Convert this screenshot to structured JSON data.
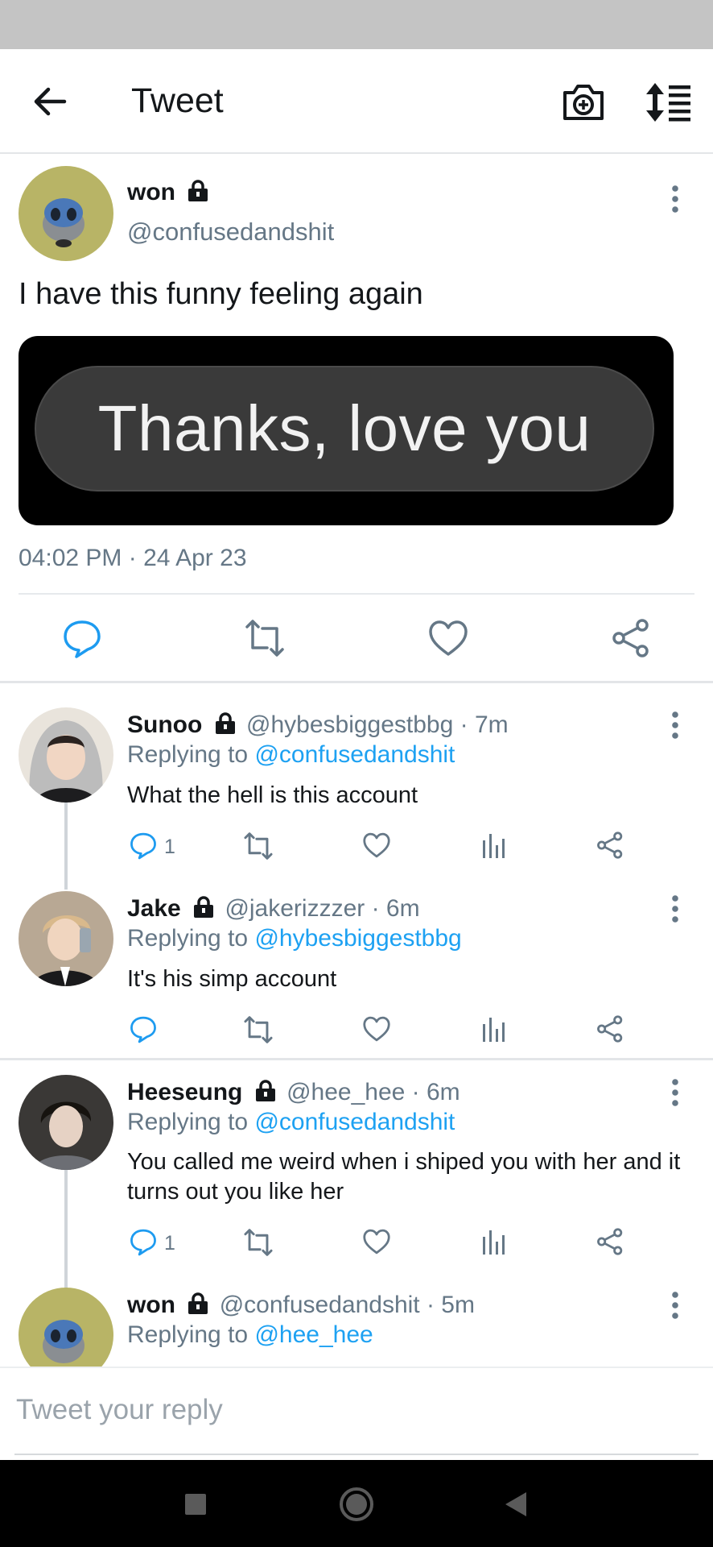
{
  "header": {
    "title": "Tweet"
  },
  "main_tweet": {
    "name": "won",
    "handle": "@confusedandshit",
    "text": "I have this funny feeling again",
    "media_text": "Thanks, love you",
    "timestamp": "04:02 PM · 24 Apr 23"
  },
  "replies": [
    {
      "name": "Sunoo",
      "handle": "@hybesbiggestbbg",
      "time": "· 7m",
      "replying_prefix": "Replying to ",
      "replying_to": "@confusedandshit",
      "text": "What the hell is this account",
      "reply_count": "1"
    },
    {
      "name": "Jake",
      "handle": "@jakerizzzer",
      "time": "· 6m",
      "replying_prefix": "Replying to ",
      "replying_to": "@hybesbiggestbbg",
      "text": "It's his simp account",
      "reply_count": ""
    },
    {
      "name": "Heeseung",
      "handle": "@hee_hee",
      "time": "· 6m",
      "replying_prefix": "Replying to ",
      "replying_to": "@confusedandshit",
      "text": "You called me weird when i shiped you with her and it turns out you like her",
      "reply_count": "1"
    },
    {
      "name": "won",
      "handle": "@confusedandshit",
      "time": "· 5m",
      "replying_prefix": "Replying to ",
      "replying_to": "@hee_hee",
      "text": "",
      "reply_count": ""
    }
  ],
  "compose": {
    "placeholder": "Tweet your reply"
  },
  "colors": {
    "link": "#1da1f2",
    "secondary": "#657786",
    "text": "#14171a"
  }
}
